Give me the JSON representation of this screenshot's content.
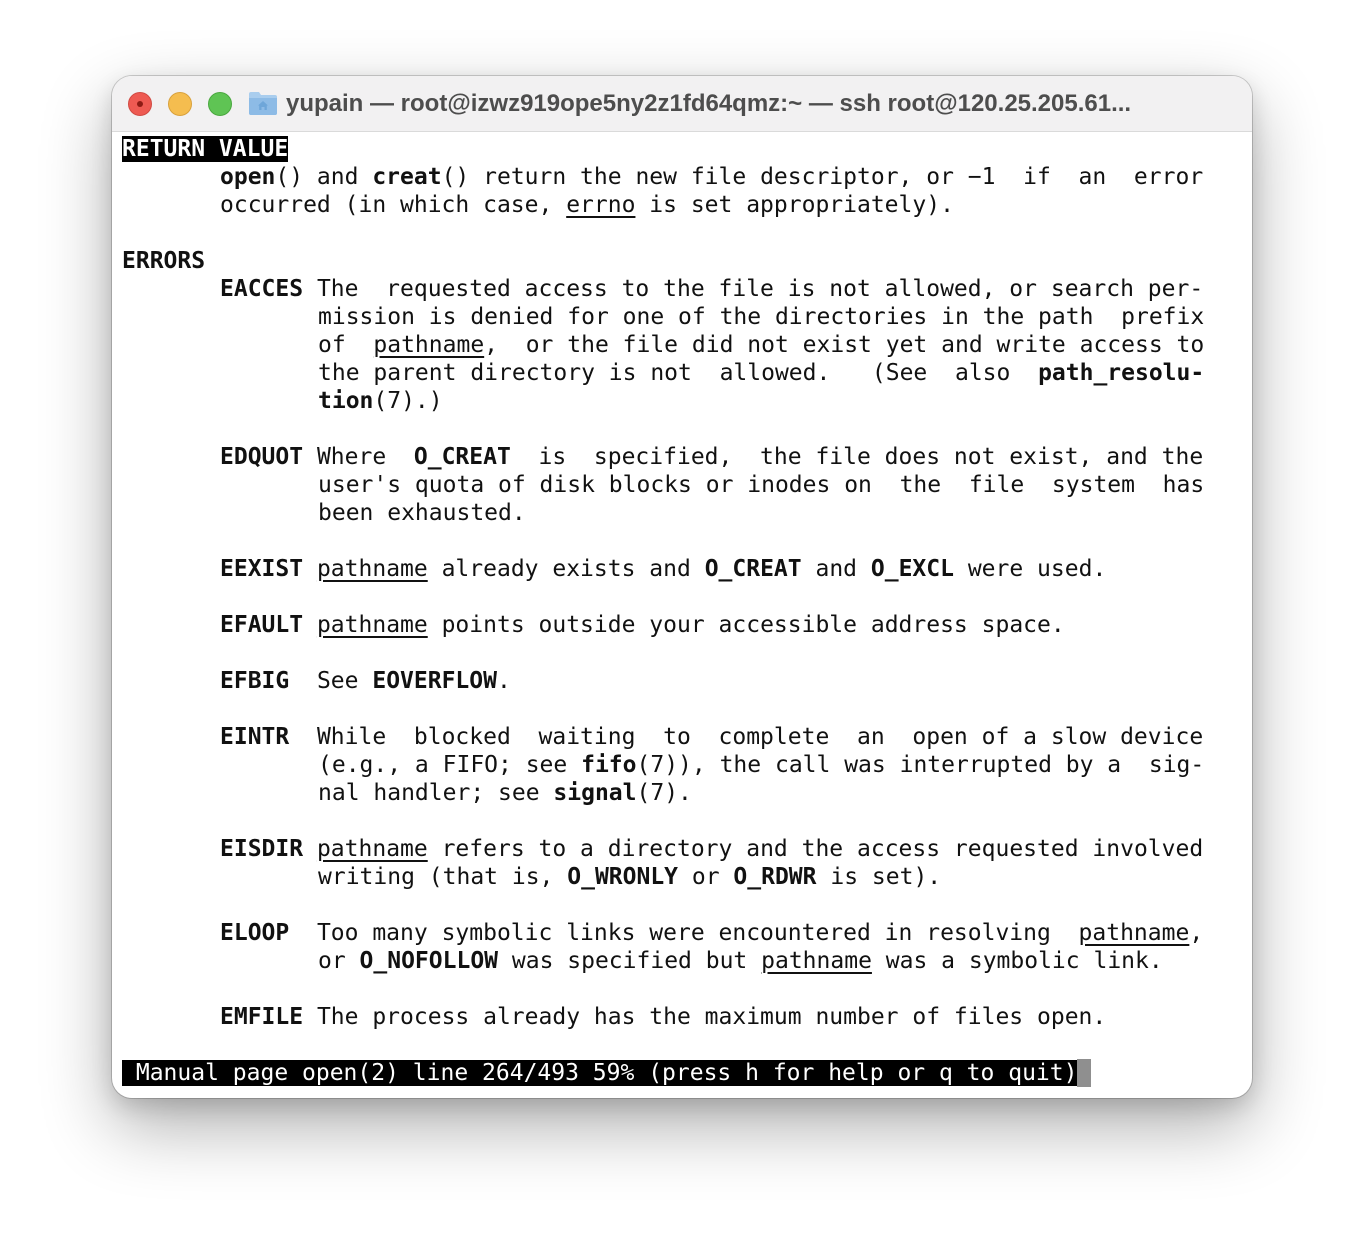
{
  "window": {
    "title": "yupain — root@izwz919ope5ny2z1fd64qmz:~ — ssh root@120.25.205.61..."
  },
  "manpage": {
    "return_value": {
      "heading": "RETURN VALUE",
      "l1": {
        "a": "open",
        "b": "() and ",
        "c": "creat",
        "d": "() return the new file descriptor, or −1  if  an  error"
      },
      "l2": {
        "a": "occurred (in which case, ",
        "b": "errno",
        "c": " is set appropriately)."
      }
    },
    "errors": {
      "heading": "ERRORS",
      "eacces": {
        "code": "EACCES",
        "l1": " The  requested access to the file is not allowed, or search per-",
        "l2": "mission is denied for one of the directories in the path  prefix",
        "l3": {
          "a": "of  ",
          "b": "pathname",
          "c": ",  or the file did not exist yet and write access to"
        },
        "l4": {
          "a": "the parent directory is not  allowed.   (See  also  ",
          "b": "path_resolu-"
        },
        "l5": {
          "a": "tion",
          "b": "(7).)"
        }
      },
      "edquot": {
        "code": "EDQUOT",
        "l1": {
          "a": " Where  ",
          "b": "O_CREAT",
          "c": "  is  specified,  the file does not exist, and the"
        },
        "l2": "user's quota of disk blocks or inodes on  the  file  system  has",
        "l3": "been exhausted."
      },
      "eexist": {
        "code": "EEXIST",
        "l1": {
          "a": " ",
          "b": "pathname",
          "c": " already exists and ",
          "d": "O_CREAT",
          "e": " and ",
          "f": "O_EXCL",
          "g": " were used."
        }
      },
      "efault": {
        "code": "EFAULT",
        "l1": {
          "a": " ",
          "b": "pathname",
          "c": " points outside your accessible address space."
        }
      },
      "efbig": {
        "code": "EFBIG",
        "l1": {
          "a": "  See ",
          "b": "EOVERFLOW",
          "c": "."
        }
      },
      "eintr": {
        "code": "EINTR",
        "l1": "  While  blocked  waiting  to  complete  an  open of a slow device",
        "l2": {
          "a": "(e.g., a FIFO; see ",
          "b": "fifo",
          "c": "(7)), the call was interrupted by a  sig-"
        },
        "l3": {
          "a": "nal handler; see ",
          "b": "signal",
          "c": "(7)."
        }
      },
      "eisdir": {
        "code": "EISDIR",
        "l1": {
          "a": " ",
          "b": "pathname",
          "c": " refers to a directory and the access requested involved"
        },
        "l2": {
          "a": "writing (that is, ",
          "b": "O_WRONLY",
          "c": " or ",
          "d": "O_RDWR",
          "e": " is set)."
        }
      },
      "eloop": {
        "code": "ELOOP",
        "l1": {
          "a": "  Too many symbolic links were encountered in resolving  ",
          "b": "pathname",
          "c": ","
        },
        "l2": {
          "a": "or ",
          "b": "O_NOFOLLOW",
          "c": " was specified but ",
          "d": "pathname",
          "e": " was a symbolic link."
        }
      },
      "emfile": {
        "code": "EMFILE",
        "l1": " The process already has the maximum number of files open."
      }
    }
  },
  "status_bar": {
    "text": " Manual page open(2) line 264/493 59% (press h for help or q to quit)"
  }
}
